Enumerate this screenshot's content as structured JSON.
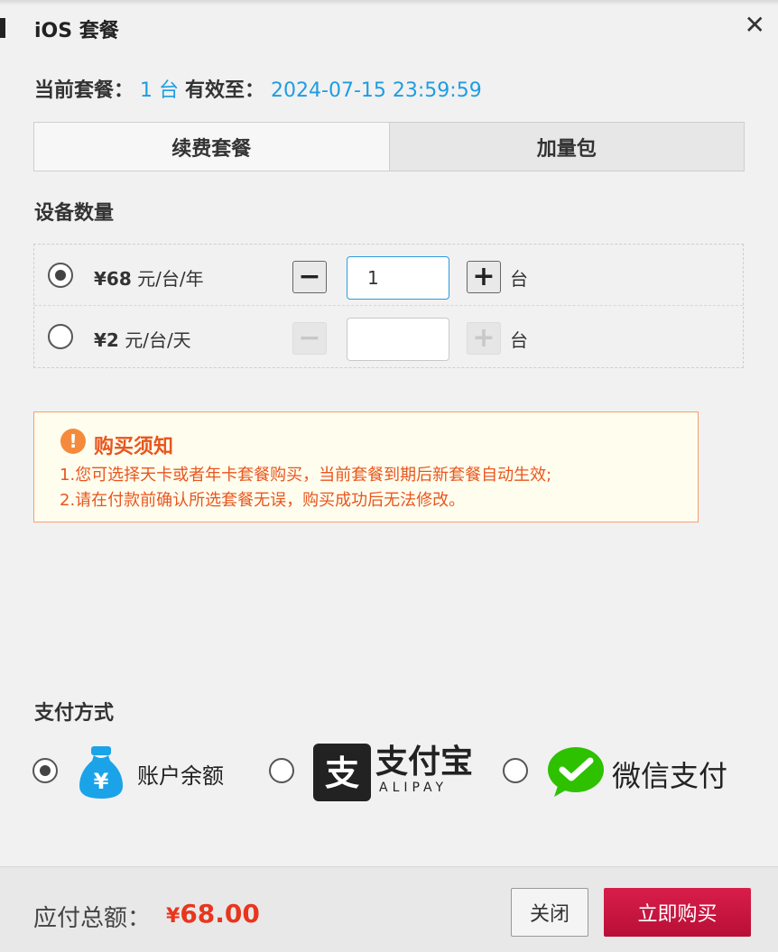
{
  "dialog": {
    "title": "iOS 套餐",
    "close_symbol": "✕"
  },
  "current_plan": {
    "label": "当前套餐：",
    "devices": "1 台",
    "valid_label": "有效至：",
    "valid_until": "2024-07-15 23:59:59"
  },
  "tabs": [
    {
      "label": "续费套餐",
      "active": true
    },
    {
      "label": "加量包",
      "active": false
    }
  ],
  "device_count": {
    "section_label": "设备数量",
    "options": [
      {
        "price": "¥68",
        "unit": "元/台/年",
        "selected": true,
        "quantity": "1",
        "qty_unit": "台",
        "minus": "−",
        "plus": "+"
      },
      {
        "price": "¥2",
        "unit": "元/台/天",
        "selected": false,
        "quantity": "",
        "qty_unit": "台",
        "minus": "−",
        "plus": "+"
      }
    ]
  },
  "notice": {
    "icon": "!",
    "title": "购买须知",
    "lines": [
      "1.您可选择天卡或者年卡套餐购买，当前套餐到期后新套餐自动生效;",
      "2.请在付款前确认所选套餐无误，购买成功后无法修改。"
    ]
  },
  "payment": {
    "section_label": "支付方式",
    "methods": [
      {
        "label": "账户余额",
        "icon": "money-bag-icon",
        "selected": true,
        "icon_text": "¥"
      },
      {
        "label": "支付宝",
        "sublabel": "ALIPAY",
        "icon": "alipay-logo",
        "selected": false,
        "logo_char": "支"
      },
      {
        "label": "微信支付",
        "icon": "wechat-pay-logo",
        "selected": false
      }
    ]
  },
  "footer": {
    "total_label": "应付总额：",
    "currency": "¥",
    "amount": "68.00",
    "close_label": "关闭",
    "buy_label": "立即购买"
  },
  "colors": {
    "accent_blue": "#1e9de2",
    "notice_orange": "#e8561e",
    "buy_red": "#c8153e",
    "balance_blue": "#1aa3e8",
    "wechat_green": "#2dc100"
  }
}
